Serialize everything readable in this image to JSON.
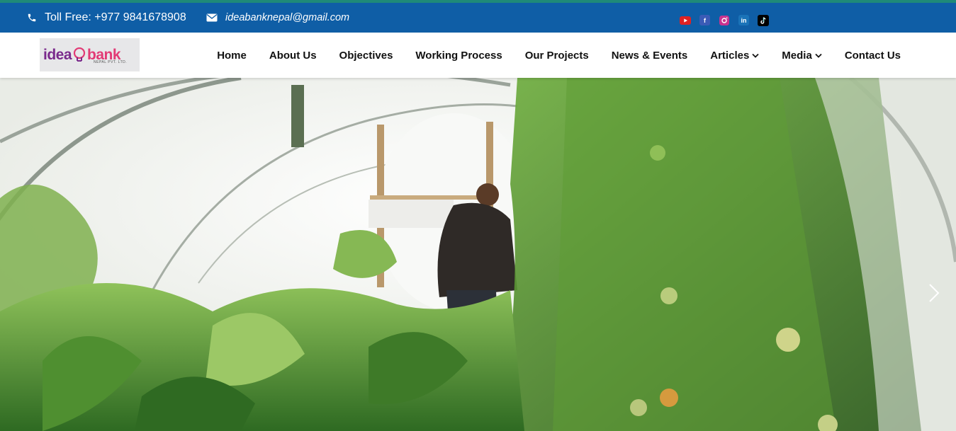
{
  "topbar": {
    "phone_text": "Toll Free: +977 9841678908",
    "email_text": "ideabanknepal@gmail.com",
    "icons": [
      "phone-icon",
      "mail-icon"
    ],
    "social": [
      {
        "name": "youtube",
        "glyph": "",
        "color": "#e02222"
      },
      {
        "name": "facebook",
        "glyph": "f",
        "color": "#3b5bb6"
      },
      {
        "name": "instagram",
        "glyph": "",
        "color": "#c8338f"
      },
      {
        "name": "linkedin",
        "glyph": "in",
        "color": "#1a73b8"
      },
      {
        "name": "tiktok",
        "glyph": "",
        "color": "#000000"
      }
    ]
  },
  "logo": {
    "word_idea": "idea",
    "word_bank": "bank",
    "subtitle": "NEPAL PVT. LTD."
  },
  "nav": {
    "items": [
      {
        "label": "Home",
        "dropdown": false
      },
      {
        "label": "About Us",
        "dropdown": false
      },
      {
        "label": "Objectives",
        "dropdown": false
      },
      {
        "label": "Working Process",
        "dropdown": false
      },
      {
        "label": "Our Projects",
        "dropdown": false
      },
      {
        "label": "News & Events",
        "dropdown": false
      },
      {
        "label": "Articles",
        "dropdown": true
      },
      {
        "label": "Media",
        "dropdown": true
      },
      {
        "label": "Contact Us",
        "dropdown": false
      }
    ]
  },
  "hero": {
    "slider_next": "chevron-right-icon"
  },
  "colors": {
    "topbar": "#0f5ea6",
    "accent_stripe": "#1f8a78",
    "nav_text": "#111111"
  }
}
